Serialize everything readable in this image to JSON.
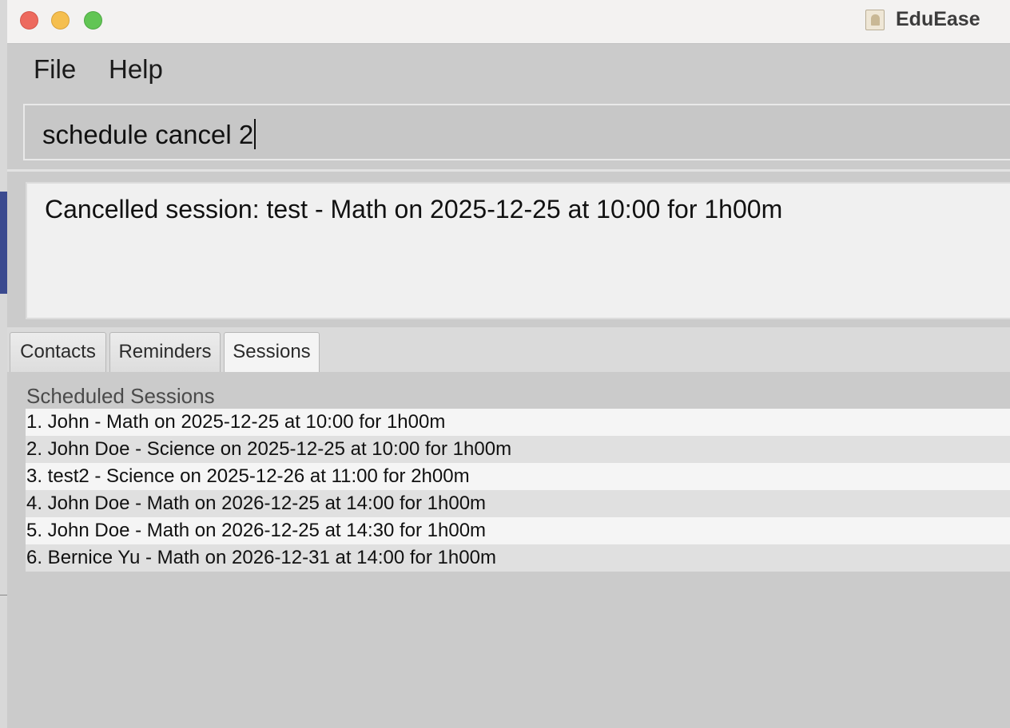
{
  "window": {
    "app_title": "EduEase",
    "app_icon": "address-book-icon"
  },
  "menu": {
    "file": "File",
    "help": "Help"
  },
  "command": {
    "value": "schedule cancel 2"
  },
  "result": {
    "message": "Cancelled session: test - Math on 2025-12-25 at 10:00 for 1h00m"
  },
  "tabs": [
    {
      "label": "Contacts",
      "selected": false
    },
    {
      "label": "Reminders",
      "selected": false
    },
    {
      "label": "Sessions",
      "selected": true
    }
  ],
  "sessions": {
    "title": "Scheduled Sessions",
    "items": [
      "1. John - Math on 2025-12-25 at 10:00 for 1h00m",
      "2. John Doe - Science on 2025-12-25 at 10:00 for 1h00m",
      "3. test2 - Science on 2025-12-26 at 11:00 for 2h00m",
      "4. John Doe - Math on 2026-12-25 at 14:00 for 1h00m",
      "5. John Doe - Math on 2026-12-25 at 14:30 for 1h00m",
      "6. Bernice Yu - Math on 2026-12-31 at 14:00 for 1h00m"
    ]
  },
  "colors": {
    "close": "#ed6a5e",
    "minimize": "#f5bf4f",
    "maximize": "#61c554",
    "window_bg": "#cbcbcb"
  }
}
